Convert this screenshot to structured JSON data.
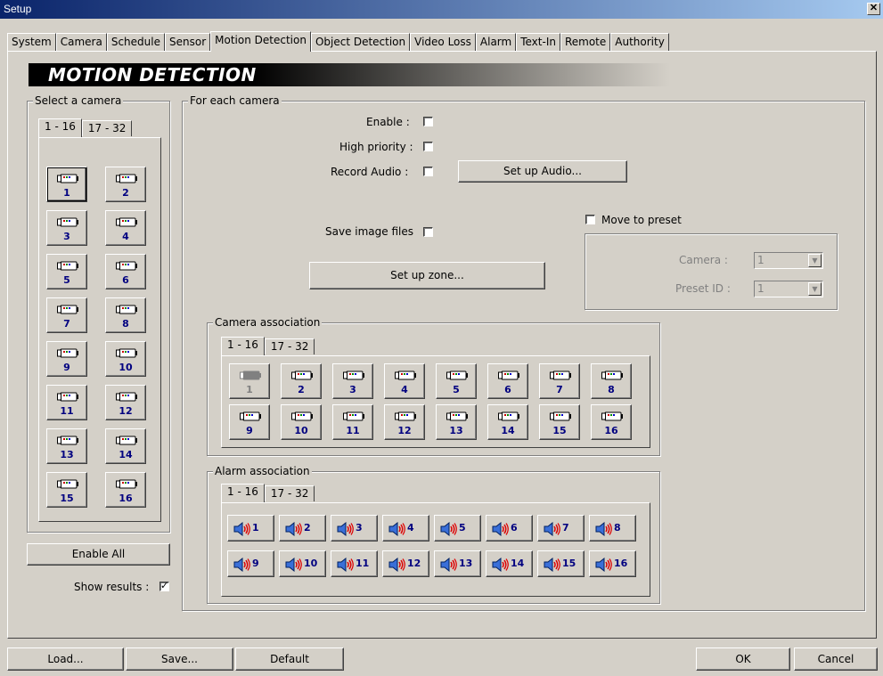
{
  "window": {
    "title": "Setup",
    "close_glyph": "✕"
  },
  "tabs": [
    "System",
    "Camera",
    "Schedule",
    "Sensor",
    "Motion Detection",
    "Object Detection",
    "Video Loss",
    "Alarm",
    "Text-In",
    "Remote",
    "Authority"
  ],
  "active_tab": "Motion Detection",
  "banner": "MOTION DETECTION",
  "select_camera": {
    "label": "Select a camera",
    "tabs": [
      "1 - 16",
      "17 - 32"
    ],
    "cameras": [
      "1",
      "2",
      "3",
      "4",
      "5",
      "6",
      "7",
      "8",
      "9",
      "10",
      "11",
      "12",
      "13",
      "14",
      "15",
      "16"
    ],
    "selected": "1"
  },
  "enable_all": "Enable All",
  "show_results": {
    "label": "Show results :",
    "checked": true
  },
  "each_camera": {
    "label": "For each camera",
    "enable": "Enable :",
    "high_priority": "High priority :",
    "record_audio": "Record Audio :",
    "setup_audio": "Set up Audio...",
    "save_image_files": "Save image files",
    "setup_zone": "Set up zone...",
    "move_to_preset": "Move to preset",
    "camera_label": "Camera :",
    "camera_value": "1",
    "preset_label": "Preset ID :",
    "preset_value": "1"
  },
  "camera_association": {
    "label": "Camera association",
    "tabs": [
      "1 - 16",
      "17 - 32"
    ],
    "cameras": [
      "1",
      "2",
      "3",
      "4",
      "5",
      "6",
      "7",
      "8",
      "9",
      "10",
      "11",
      "12",
      "13",
      "14",
      "15",
      "16"
    ],
    "disabled": "1"
  },
  "alarm_association": {
    "label": "Alarm association",
    "tabs": [
      "1 - 16",
      "17 - 32"
    ],
    "alarms": [
      "1",
      "2",
      "3",
      "4",
      "5",
      "6",
      "7",
      "8",
      "9",
      "10",
      "11",
      "12",
      "13",
      "14",
      "15",
      "16"
    ]
  },
  "footer": {
    "load": "Load...",
    "save": "Save...",
    "default": "Default",
    "ok": "OK",
    "cancel": "Cancel"
  },
  "icons": {
    "camera": "camera-icon",
    "alarm": "speaker-icon"
  }
}
